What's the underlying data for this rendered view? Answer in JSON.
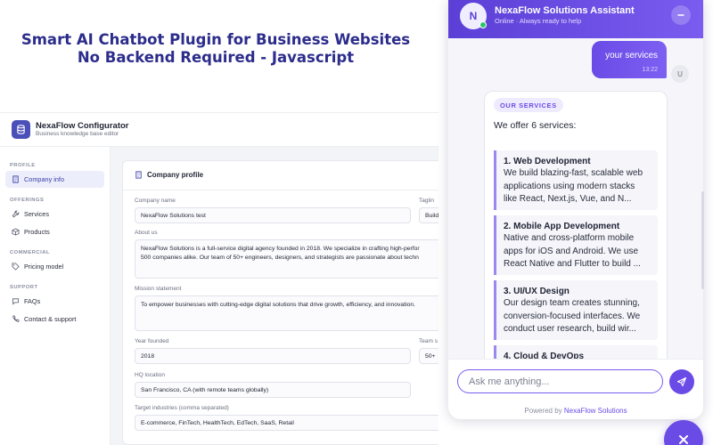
{
  "hero": {
    "line1": "Smart AI Chatbot Plugin for Business Websites",
    "line2": "No Backend Required - Javascript"
  },
  "app": {
    "name": "NexaFlow Configurator",
    "subtitle": "Business knowledge base editor",
    "sidebar": {
      "groups": [
        {
          "label": "PROFILE",
          "items": [
            {
              "label": "Company info",
              "icon": "building-icon",
              "active": true
            }
          ]
        },
        {
          "label": "OFFERINGS",
          "items": [
            {
              "label": "Services",
              "icon": "wrench-icon"
            },
            {
              "label": "Products",
              "icon": "box-icon"
            }
          ]
        },
        {
          "label": "COMMERCIAL",
          "items": [
            {
              "label": "Pricing model",
              "icon": "tag-icon"
            }
          ]
        },
        {
          "label": "SUPPORT",
          "items": [
            {
              "label": "FAQs",
              "icon": "chat-icon"
            },
            {
              "label": "Contact & support",
              "icon": "phone-icon"
            }
          ]
        }
      ]
    },
    "profile": {
      "title": "Company profile",
      "company_name_label": "Company name",
      "company_name_value": "NexaFlow Solutions test",
      "tagline_label": "Taglin",
      "tagline_value": "Build",
      "about_label": "About us",
      "about_line1": "NexaFlow Solutions is a full-service digital agency founded in 2018. We specialize in crafting high-perfor",
      "about_line2": "500 companies alike. Our team of 50+ engineers, designers, and strategists are passionate about techn",
      "mission_label": "Mission statement",
      "mission_value": "To empower businesses with cutting-edge digital solutions that drive growth, efficiency, and innovation.",
      "year_label": "Year founded",
      "year_value": "2018",
      "team_label": "Team s",
      "team_value": "50+",
      "hq_label": "HQ location",
      "hq_value": "San Francisco, CA (with remote teams globally)",
      "industries_label": "Target industries (comma separated)",
      "industries_value": "E-commerce, FinTech, HealthTech, EdTech, SaaS, Retail"
    }
  },
  "chat": {
    "bot_initial": "N",
    "bot_name": "NexaFlow Solutions Assistant",
    "bot_status": "Online · Always ready to help",
    "user_message": "your services",
    "user_time": "13:22",
    "user_initial": "U",
    "reply": {
      "badge": "OUR SERVICES",
      "intro": "We offer 6 services:",
      "services": [
        {
          "name": "1. Web Development",
          "desc": "We build blazing-fast, scalable web applications using modern stacks like React, Next.js, Vue, and N..."
        },
        {
          "name": "2. Mobile App Development",
          "desc": "Native and cross-platform mobile apps for iOS and Android. We use React Native and Flutter to build ..."
        },
        {
          "name": "3. UI/UX Design",
          "desc": "Our design team creates stunning, conversion-focused interfaces. We conduct user research, build wir..."
        },
        {
          "name": "4. Cloud & DevOps",
          "desc": ""
        }
      ]
    },
    "input_placeholder": "Ask me anything...",
    "powered_prefix": "Powered by",
    "powered_brand": "NexaFlow Solutions"
  },
  "colors": {
    "accent": "#6a4be6",
    "hero_title": "#2c2c8c",
    "sidebar_active": "#eceefb",
    "online": "#2ec46b"
  }
}
